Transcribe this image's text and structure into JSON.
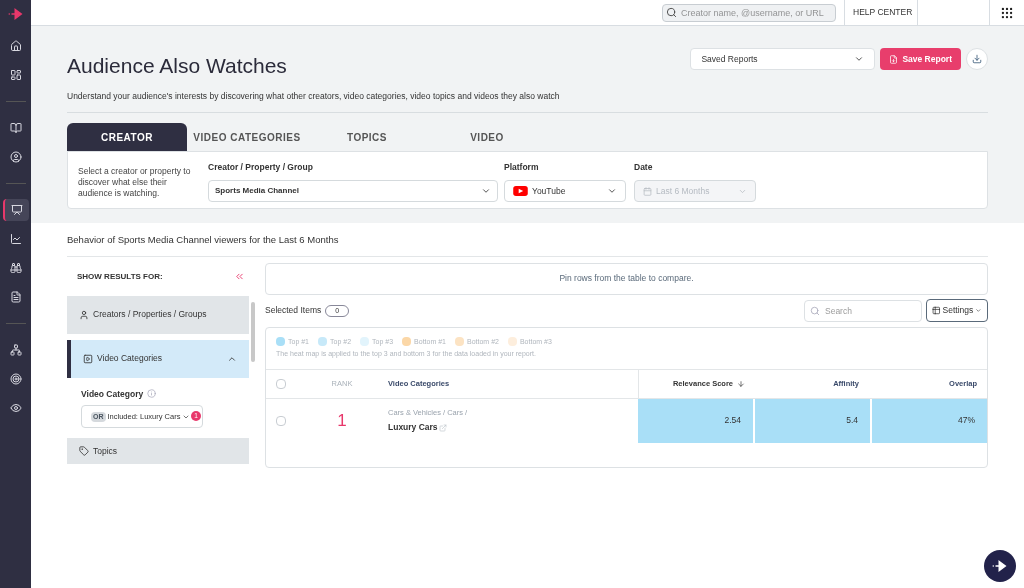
{
  "sidebar": {
    "items": [
      {
        "selected": false
      },
      {
        "selected": false
      },
      {
        "selected": false
      },
      {
        "selected": false
      },
      {
        "selected": true
      },
      {
        "selected": false
      },
      {
        "selected": false
      },
      {
        "selected": false
      },
      {
        "selected": false
      },
      {
        "selected": false
      },
      {
        "selected": false
      }
    ]
  },
  "topbar": {
    "search_placeholder": "Creator name, @username, or URL",
    "help": "HELP CENTER"
  },
  "header": {
    "title": "Audience Also Watches",
    "subtitle": "Understand your audience's interests by discovering what other creators, video categories, video topics and videos they also watch",
    "saved_reports": "Saved Reports",
    "save_button": "Save Report"
  },
  "tabs": [
    {
      "label": "CREATOR",
      "selected": true
    },
    {
      "label": "VIDEO CATEGORIES",
      "selected": false
    },
    {
      "label": "TOPICS",
      "selected": false
    },
    {
      "label": "VIDEO",
      "selected": false
    }
  ],
  "filters": {
    "hint": "Select a creator or property to discover what else their audience is watching.",
    "creator_label": "Creator / Property / Group",
    "creator_value": "Sports Media Channel",
    "platform_label": "Platform",
    "platform_value": "YouTube",
    "date_label": "Date",
    "date_value": "Last 6 Months",
    "date_disabled": true
  },
  "behavior_title": "Behavior of Sports Media Channel viewers for the Last 6 Months",
  "results_panel": {
    "heading": "SHOW RESULTS FOR:",
    "sections": [
      {
        "label": "Creators / Properties / Groups",
        "expanded": false
      },
      {
        "label": "Video Categories",
        "expanded": true
      },
      {
        "label": "Topics",
        "expanded": false
      }
    ],
    "field_label": "Video Category",
    "chip": "OR",
    "field_value": "Included: Luxury Cars",
    "badge": "1"
  },
  "pin_message": "Pin rows from the table to compare.",
  "selected_items": {
    "label": "Selected Items",
    "count": "0"
  },
  "search_placeholder": "Search",
  "settings": "Settings",
  "legend": [
    {
      "label": "Top #1",
      "color": "#a9dff7"
    },
    {
      "label": "Top #2",
      "color": "#c7e9f9"
    },
    {
      "label": "Top #3",
      "color": "#e2f4fc"
    },
    {
      "label": "Bottom #1",
      "color": "#fbd7a7"
    },
    {
      "label": "Bottom #2",
      "color": "#fce3c3"
    },
    {
      "label": "Bottom #3",
      "color": "#fdeedd"
    }
  ],
  "legend_note": "The heat map is applied to the top 3 and bottom 3 for the data loaded in your report.",
  "table": {
    "columns": [
      "RANK",
      "Video Categories",
      "Relevance Score",
      "Affinity",
      "Overlap"
    ],
    "all_checked": false,
    "rows": [
      {
        "checked": false,
        "cells": [
          {
            "kind": "rank",
            "value": "1"
          },
          {
            "kind": "category",
            "path": "Cars & Vehicles / Cars /",
            "value": "Luxury Cars"
          },
          {
            "kind": "metric",
            "value": "2.54",
            "color": "#a9dff7"
          },
          {
            "kind": "metric",
            "value": "5.4",
            "color": "#a9dff7"
          },
          {
            "kind": "metric",
            "value": "47%",
            "color": "#a9dff7"
          }
        ]
      }
    ]
  }
}
